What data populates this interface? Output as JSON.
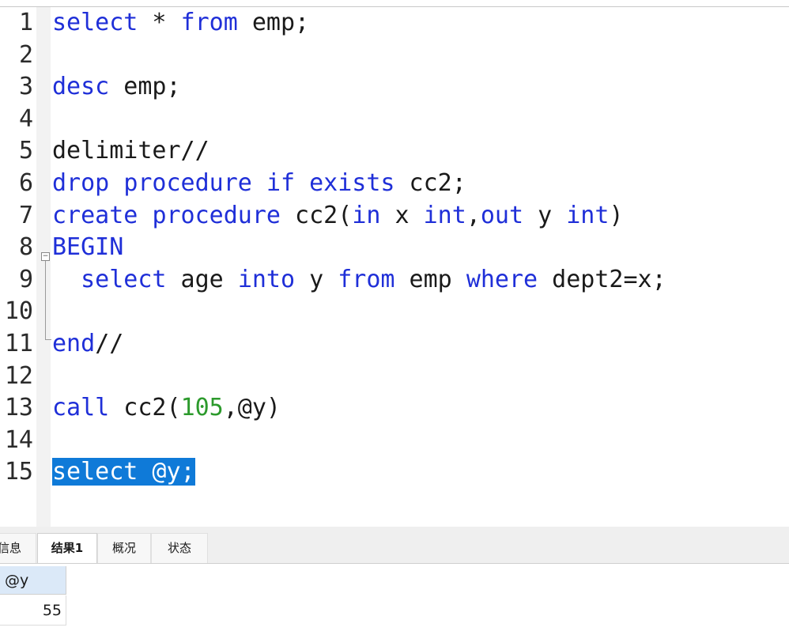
{
  "editor": {
    "lines": [
      {
        "n": "1",
        "tokens": [
          [
            "kw",
            "select"
          ],
          [
            "plain",
            " * "
          ],
          [
            "kw",
            "from"
          ],
          [
            "plain",
            " emp;"
          ]
        ]
      },
      {
        "n": "2",
        "tokens": []
      },
      {
        "n": "3",
        "tokens": [
          [
            "kw",
            "desc"
          ],
          [
            "plain",
            " emp;"
          ]
        ]
      },
      {
        "n": "4",
        "tokens": []
      },
      {
        "n": "5",
        "tokens": [
          [
            "plain",
            "delimiter//"
          ]
        ]
      },
      {
        "n": "6",
        "tokens": [
          [
            "kw",
            "drop"
          ],
          [
            "plain",
            " "
          ],
          [
            "kw",
            "procedure"
          ],
          [
            "plain",
            " "
          ],
          [
            "kw",
            "if"
          ],
          [
            "plain",
            " "
          ],
          [
            "kw",
            "exists"
          ],
          [
            "plain",
            " cc2;"
          ]
        ]
      },
      {
        "n": "7",
        "tokens": [
          [
            "kw",
            "create"
          ],
          [
            "plain",
            " "
          ],
          [
            "kw",
            "procedure"
          ],
          [
            "plain",
            " cc2("
          ],
          [
            "kw",
            "in"
          ],
          [
            "plain",
            " x "
          ],
          [
            "kw",
            "int"
          ],
          [
            "plain",
            ","
          ],
          [
            "kw",
            "out"
          ],
          [
            "plain",
            " y "
          ],
          [
            "kw",
            "int"
          ],
          [
            "plain",
            ")"
          ]
        ]
      },
      {
        "n": "8",
        "tokens": [
          [
            "kw",
            "BEGIN"
          ]
        ]
      },
      {
        "n": "9",
        "tokens": [
          [
            "plain",
            "  "
          ],
          [
            "kw",
            "select"
          ],
          [
            "plain",
            " age "
          ],
          [
            "kw",
            "into"
          ],
          [
            "plain",
            " y "
          ],
          [
            "kw",
            "from"
          ],
          [
            "plain",
            " emp "
          ],
          [
            "kw",
            "where"
          ],
          [
            "plain",
            " dept2=x;"
          ]
        ]
      },
      {
        "n": "10",
        "tokens": []
      },
      {
        "n": "11",
        "tokens": [
          [
            "kw",
            "end"
          ],
          [
            "plain",
            "//"
          ]
        ]
      },
      {
        "n": "12",
        "tokens": []
      },
      {
        "n": "13",
        "tokens": [
          [
            "kw",
            "call"
          ],
          [
            "plain",
            " cc2("
          ],
          [
            "num",
            "105"
          ],
          [
            "plain",
            ",@y)"
          ]
        ]
      },
      {
        "n": "14",
        "tokens": []
      },
      {
        "n": "15",
        "tokens": [
          [
            "sel",
            "select @y;"
          ]
        ]
      }
    ]
  },
  "result_tabs": [
    {
      "label": "信息",
      "active": false
    },
    {
      "label": "结果1",
      "active": true
    },
    {
      "label": "概况",
      "active": false
    },
    {
      "label": "状态",
      "active": false
    }
  ],
  "result_grid": {
    "column": "@y",
    "value": "55"
  }
}
